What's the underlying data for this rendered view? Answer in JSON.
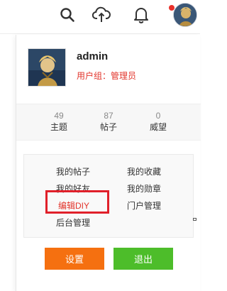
{
  "topbar": {
    "icons": [
      "search-icon",
      "upload-cloud-icon",
      "bell-icon"
    ],
    "notification_dot_color": "#e8302a"
  },
  "profile": {
    "username": "admin",
    "usergroup": "用户组：管理员"
  },
  "stats": [
    {
      "value": "49",
      "label": "主题"
    },
    {
      "value": "87",
      "label": "帖子"
    },
    {
      "value": "0",
      "label": "威望"
    }
  ],
  "menu": {
    "my_posts": "我的帖子",
    "my_favorites": "我的收藏",
    "my_friends": "我的好友",
    "my_medals": "我的勋章",
    "edit_diy": "编辑DIY",
    "portal_manage": "门户管理",
    "admin_panel": "后台管理"
  },
  "buttons": {
    "settings": "设置",
    "logout": "退出"
  },
  "colors": {
    "accent_red": "#e2342b",
    "settings_orange": "#f57010",
    "logout_green": "#4dbd2a"
  }
}
